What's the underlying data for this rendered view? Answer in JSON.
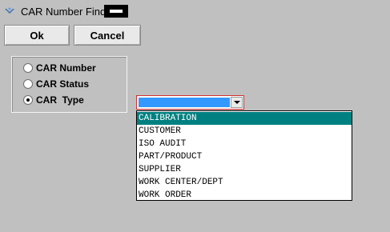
{
  "window": {
    "title": "CAR Number Find"
  },
  "toolbar": {
    "ok_label": "Ok",
    "cancel_label": "Cancel"
  },
  "search_by": {
    "options": [
      {
        "label": "CAR Number",
        "checked": false
      },
      {
        "label": "CAR Status",
        "checked": false
      },
      {
        "label": "CAR  Type",
        "checked": true
      }
    ]
  },
  "type_combo": {
    "value": "",
    "options": [
      "CALIBRATION",
      "CUSTOMER",
      "ISO AUDIT",
      "PART/PRODUCT",
      "SUPPLIER",
      "WORK CENTER/DEPT",
      "WORK ORDER"
    ],
    "highlighted_index": 0
  },
  "colors": {
    "background": "#c0c0c0",
    "selection_highlight": "#008080",
    "combo_fill": "#3399ff"
  }
}
